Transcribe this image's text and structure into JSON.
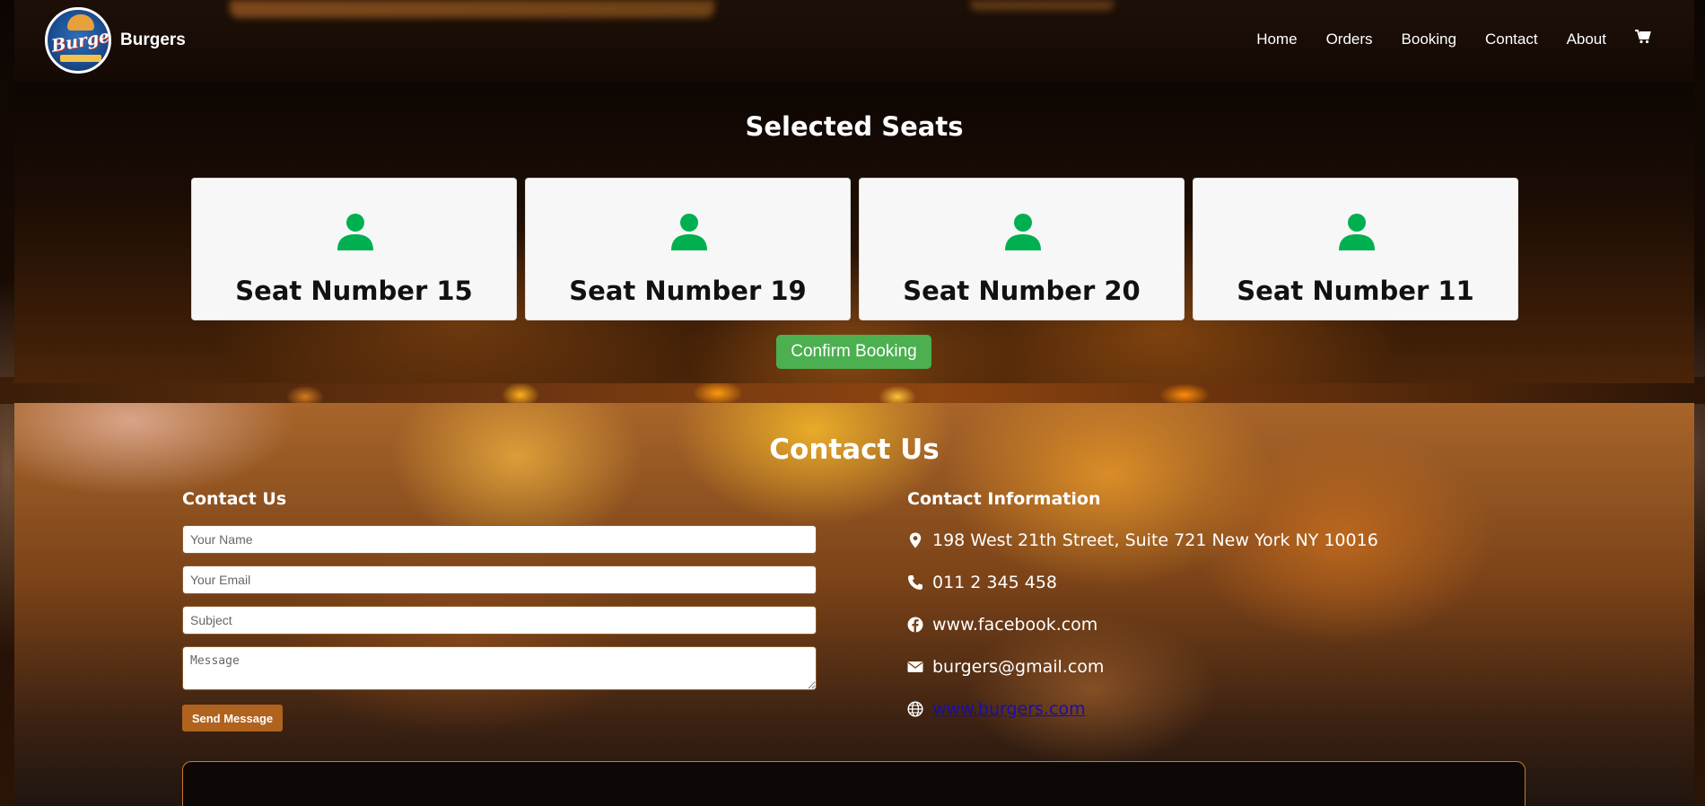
{
  "header": {
    "brand": "Burgers",
    "logo_text": "Burgers",
    "nav": [
      "Home",
      "Orders",
      "Booking",
      "Contact",
      "About"
    ],
    "cart_icon": "cart-icon"
  },
  "seats": {
    "title": "Selected Seats",
    "items": [
      {
        "label": "Seat Number 15",
        "icon": "person-icon"
      },
      {
        "label": "Seat Number 19",
        "icon": "person-icon"
      },
      {
        "label": "Seat Number 20",
        "icon": "person-icon"
      },
      {
        "label": "Seat Number 11",
        "icon": "person-icon"
      }
    ],
    "confirm_label": "Confirm Booking",
    "accent": "#00b050",
    "button_color": "#4caf50"
  },
  "contact": {
    "title": "Contact Us",
    "form": {
      "heading": "Contact Us",
      "name_placeholder": "Your Name",
      "email_placeholder": "Your Email",
      "subject_placeholder": "Subject",
      "message_placeholder": "Message",
      "send_label": "Send Message",
      "button_color": "#b0621f"
    },
    "info": {
      "heading": "Contact Information",
      "address": "198 West 21th Street, Suite 721 New York NY 10016",
      "phone": "011 2 345 458",
      "facebook": "www.facebook.com",
      "email": "burgers@gmail.com",
      "website": "www.burgers.com"
    }
  }
}
